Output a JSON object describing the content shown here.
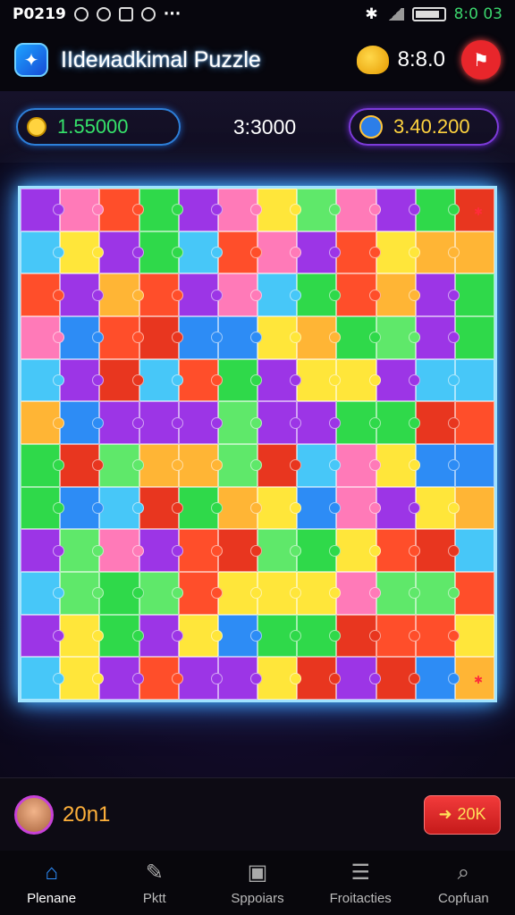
{
  "status_bar": {
    "left_text": "P0219",
    "time": "8:0 03"
  },
  "header": {
    "title": "IIdeиadkimal Puzzle",
    "score": "8:8.0"
  },
  "stats": {
    "coins": "1.55000",
    "timer": "3:3000",
    "gems": "3.40.200"
  },
  "board": {
    "rows": 12,
    "cols": 12,
    "palette": [
      "#ffe63a",
      "#ff4e2a",
      "#2fd94a",
      "#2d8cf5",
      "#9c35e6",
      "#ff7ab8",
      "#47c7f8",
      "#e8361f",
      "#5fe86a",
      "#ffb535"
    ]
  },
  "footer": {
    "player_score": "20n1",
    "action_label": "20K"
  },
  "nav": [
    {
      "label": "Plenane",
      "icon": "home-icon"
    },
    {
      "label": "Pktt",
      "icon": "tools-icon"
    },
    {
      "label": "Sppoiars",
      "icon": "gallery-icon"
    },
    {
      "label": "Froitacties",
      "icon": "list-icon"
    },
    {
      "label": "Copfuan",
      "icon": "search-icon"
    }
  ],
  "colors": {
    "accent_blue": "#2d8fff",
    "board_glow": "#49b7ff",
    "coin_green": "#36e36b",
    "gold": "#ffd33f",
    "alert_red": "#e8262b"
  }
}
